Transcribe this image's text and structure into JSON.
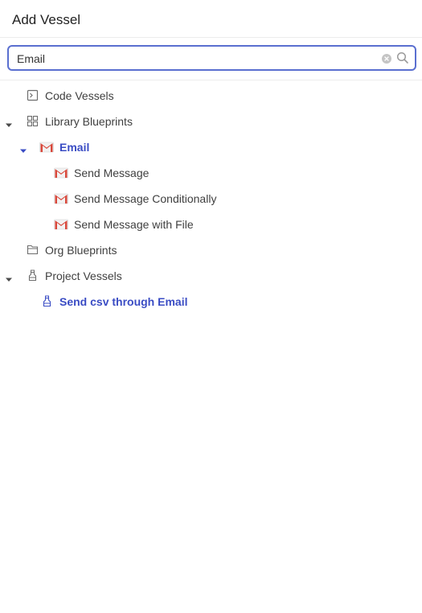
{
  "header": {
    "title": "Add Vessel"
  },
  "search": {
    "value": "Email"
  },
  "tree": {
    "code_vessels": {
      "label": "Code Vessels",
      "icon": "terminal-icon"
    },
    "library_blueprints": {
      "label": "Library Blueprints",
      "icon": "grid-icon",
      "expanded": true
    },
    "email_group": {
      "label": "Email",
      "icon": "gmail-icon",
      "expanded": true
    },
    "email_items": [
      {
        "label": "Send Message",
        "icon": "gmail-icon"
      },
      {
        "label": "Send Message Conditionally",
        "icon": "gmail-icon"
      },
      {
        "label": "Send Message with File",
        "icon": "gmail-icon"
      }
    ],
    "org_blueprints": {
      "label": "Org Blueprints",
      "icon": "folder-icon"
    },
    "project_vessels": {
      "label": "Project Vessels",
      "icon": "bottle-icon",
      "expanded": true
    },
    "project_items": [
      {
        "label": "Send csv through Email",
        "icon": "bottle-icon"
      }
    ]
  },
  "colors": {
    "accent": "#3a4cc4",
    "focus_border": "#5a6fd0",
    "gmail_red": "#d8473a"
  }
}
